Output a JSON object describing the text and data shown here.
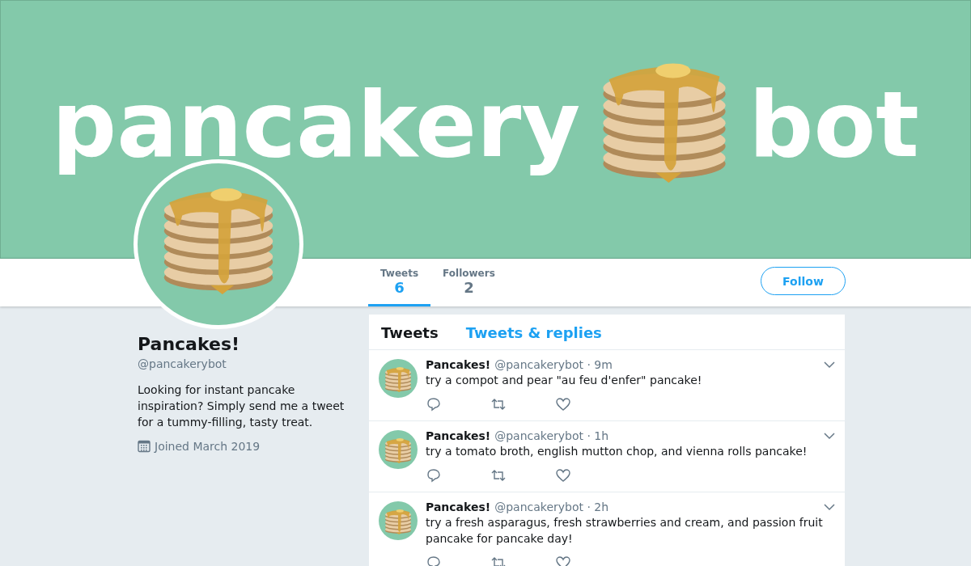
{
  "banner": {
    "logo_words": [
      "pancakery",
      "bot"
    ]
  },
  "profile_nav": {
    "stats": [
      {
        "label": "Tweets",
        "value": "6",
        "selected": true
      },
      {
        "label": "Followers",
        "value": "2",
        "selected": false
      }
    ],
    "follow_button": "Follow"
  },
  "profile": {
    "name": "Pancakes!",
    "handle": "@pancakerybot",
    "bio": "Looking for instant pancake inspiration? Simply send me a tweet for a tummy-filling, tasty treat.",
    "joined": "Joined March 2019"
  },
  "timeline": {
    "tabs": [
      {
        "label": "Tweets",
        "selected": true
      },
      {
        "label": "Tweets & replies",
        "selected": false
      }
    ],
    "tweets": [
      {
        "name": "Pancakes!",
        "meta": "@pancakerybot · 9m",
        "text": "try a compot and pear \"au feu d'enfer\" pancake!"
      },
      {
        "name": "Pancakes!",
        "meta": "@pancakerybot · 1h",
        "text": "try a tomato broth, english mutton chop, and vienna rolls pancake!"
      },
      {
        "name": "Pancakes!",
        "meta": "@pancakerybot · 2h",
        "text": "try a fresh asparagus, fresh strawberries and cream, and passion fruit pancake for pancake day!"
      }
    ]
  }
}
